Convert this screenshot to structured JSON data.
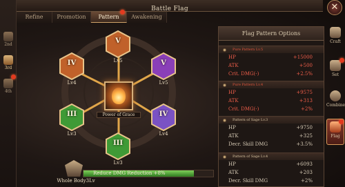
{
  "window": {
    "title": "Battle Flag",
    "close_icon": "close-icon"
  },
  "tabs": [
    {
      "label": "Refine",
      "active": false,
      "badge": false
    },
    {
      "label": "Promotion",
      "active": false,
      "badge": false
    },
    {
      "label": "Pattern",
      "active": true,
      "badge": true
    },
    {
      "label": "Awakening",
      "active": false,
      "badge": false
    }
  ],
  "left_rail": [
    {
      "label": "2nd",
      "icon": "flag-slot-icon",
      "active": false
    },
    {
      "label": "3rd",
      "icon": "flag-slot-icon",
      "active": true
    },
    {
      "label": "4th",
      "icon": "flag-slot-icon",
      "active": false
    }
  ],
  "right_rail": [
    {
      "label": "Craft",
      "icon": "anvil-icon",
      "active": false
    },
    {
      "label": "Set",
      "icon": "armor-icon",
      "active": false
    },
    {
      "label": "Combine",
      "icon": "ring-icon",
      "active": false
    },
    {
      "label": "Flag",
      "icon": "flag-icon",
      "active": true
    }
  ],
  "pattern": {
    "center_caption": "Power of Grace",
    "nodes": [
      {
        "roman": "V",
        "level": "Lv5",
        "color": "#c0612a"
      },
      {
        "roman": "V",
        "level": "Lv5",
        "color": "#8a3fb8"
      },
      {
        "roman": "IV",
        "level": "Lv4",
        "color": "#7a52c4"
      },
      {
        "roman": "III",
        "level": "Lv3",
        "color": "#3f9a36"
      },
      {
        "roman": "III",
        "level": "Lv3",
        "color": "#3f9a36"
      },
      {
        "roman": "IV",
        "level": "Lv4",
        "color": "#c0612a"
      }
    ]
  },
  "whole_body": {
    "label": "Whole Body3Lv",
    "bonus_text": "Reduce DMG Reduction +8%",
    "progress_percent": 85
  },
  "options": {
    "title": "Flag Pattern Options",
    "groups": [
      {
        "header": "Pure Pattern Lv.5",
        "tone": "red",
        "stats": [
          {
            "name": "HP",
            "value": "+15000"
          },
          {
            "name": "ATK",
            "value": "+500"
          },
          {
            "name": "Crit. DMG(-)",
            "value": "+2.5%"
          }
        ]
      },
      {
        "header": "Pure Pattern Lv.4",
        "tone": "red",
        "stats": [
          {
            "name": "HP",
            "value": "+9575"
          },
          {
            "name": "ATK",
            "value": "+313"
          },
          {
            "name": "Crit. DMG(-)",
            "value": "+2%"
          }
        ]
      },
      {
        "header": "Pattern of Sage Lv.3",
        "tone": "grey",
        "stats": [
          {
            "name": "HP",
            "value": "+9750"
          },
          {
            "name": "ATK",
            "value": "+325"
          },
          {
            "name": "Decr. Skill DMG",
            "value": "+3.5%"
          }
        ]
      },
      {
        "header": "Pattern of Sage Lv.4",
        "tone": "grey",
        "stats": [
          {
            "name": "HP",
            "value": "+6093"
          },
          {
            "name": "ATK",
            "value": "+203"
          },
          {
            "name": "Decr. Skill DMG",
            "value": "+2%"
          }
        ]
      }
    ]
  },
  "colors": {
    "accent": "#d7b07a",
    "red_stat": "#ef5e4a",
    "progress": "#5fb63f"
  }
}
